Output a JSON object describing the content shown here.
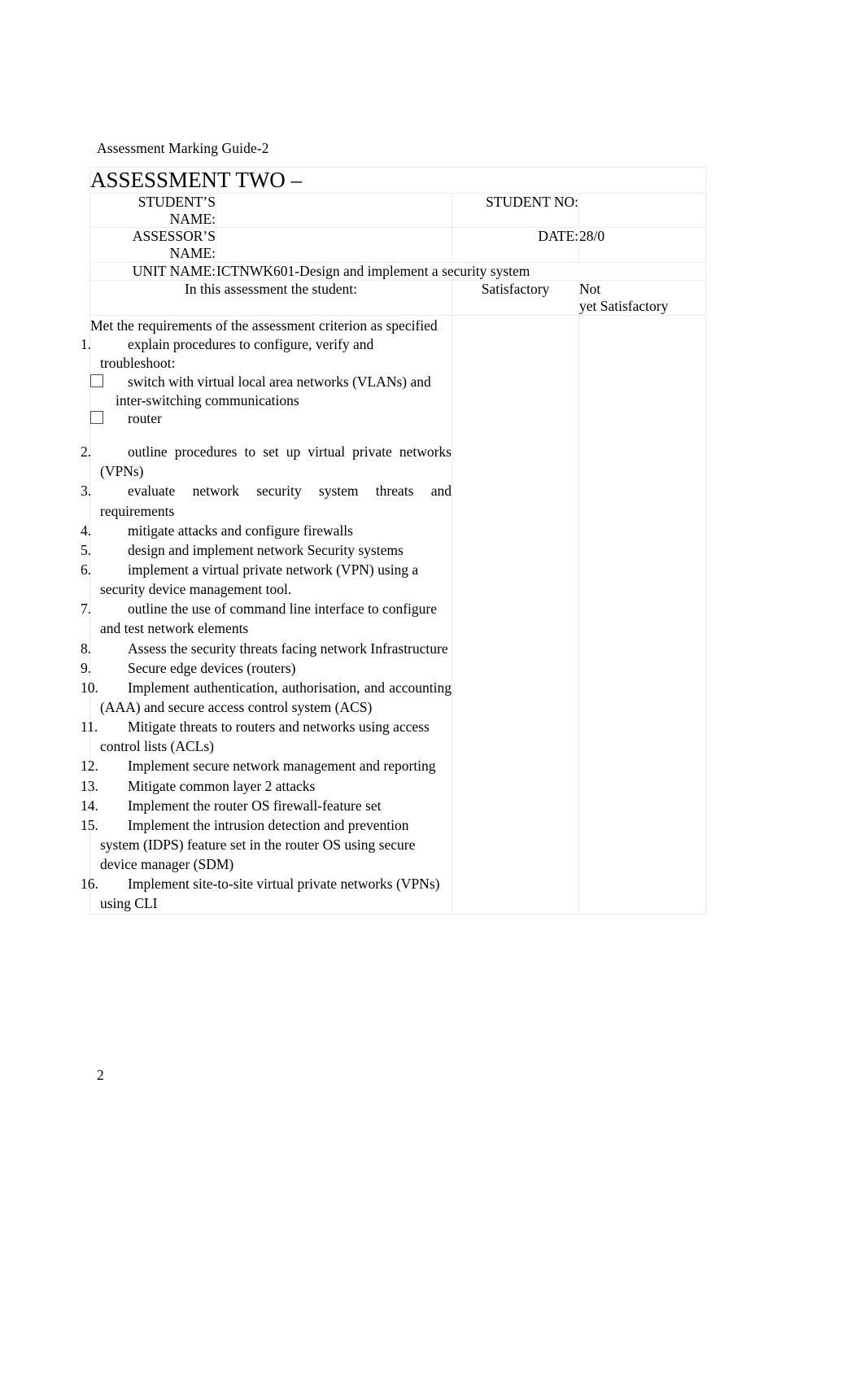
{
  "document": {
    "running_header": "Assessment Marking Guide-2",
    "page_number": "2"
  },
  "table": {
    "title": "ASSESSMENT TWO –",
    "fields": {
      "student_name_label": "STUDENT’S NAME:",
      "student_name_value": "",
      "student_no_label": "STUDENT NO:",
      "student_no_value": "",
      "assessor_name_label": "ASSESSOR’S NAME:",
      "assessor_name_value": "",
      "date_label": "DATE:",
      "date_value": "28/0",
      "unit_name_label": "UNIT NAME:",
      "unit_name_value": "ICTNWK601-Design and implement a security system"
    },
    "column_headers": {
      "criteria": "In this assessment the student:",
      "satisfactory": "Satisfactory",
      "not_yet_satisfactory_line1": "Not",
      "not_yet_satisfactory_line2": "yet Satisfactory"
    },
    "criteria": {
      "intro": "Met the requirements of the assessment criterion as specified",
      "items": [
        {
          "number": "1.",
          "text": "explain procedures to configure, verify and troubleshoot:",
          "subitems": [
            "switch with virtual local area networks (VLANs) and inter-switching communications",
            "router"
          ]
        },
        {
          "number": "2.",
          "text": "outline procedures to set up virtual private networks (VPNs)"
        },
        {
          "number": "3.",
          "text": "evaluate network security system threats and requirements"
        },
        {
          "number": "4.",
          "text": "mitigate attacks and configure firewalls"
        },
        {
          "number": "5.",
          "text": "design and implement network Security systems"
        },
        {
          "number": "6.",
          "text": "implement a virtual private network (VPN) using a security device management tool."
        },
        {
          "number": "7.",
          "text": "outline the use of command line interface to configure and test network elements"
        },
        {
          "number": "8.",
          "text": "Assess the security threats facing network Infrastructure"
        },
        {
          "number": "9.",
          "text": "Secure edge devices (routers)"
        },
        {
          "number": "10.",
          "text": "Implement authentication, authorisation, and accounting (AAA) and secure access control system (ACS)"
        },
        {
          "number": "11.",
          "text": "Mitigate threats to routers and networks using access control lists (ACLs)"
        },
        {
          "number": "12.",
          "text": "Implement secure network management and reporting"
        },
        {
          "number": "13.",
          "text": "Mitigate common layer 2 attacks"
        },
        {
          "number": "14.",
          "text": "Implement the router OS firewall-feature set"
        },
        {
          "number": "15.",
          "text": "Implement the intrusion detection and prevention system (IDPS) feature set in the router OS using secure device manager (SDM)"
        },
        {
          "number": "16.",
          "text": "Implement site-to-site virtual private networks (VPNs) using CLI"
        }
      ]
    }
  }
}
